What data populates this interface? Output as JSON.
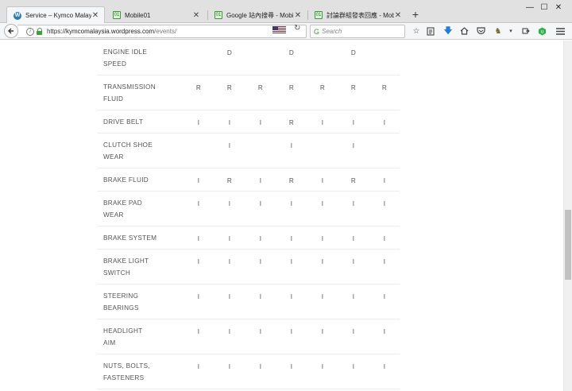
{
  "tabs": [
    {
      "label": "Service – Kymco Malaysia",
      "favicon": "wordpress-icon",
      "active": true
    },
    {
      "label": "Mobile01",
      "favicon": "mobile01-icon",
      "active": false
    },
    {
      "label": "Google 站內搜尋 - Mobile...",
      "favicon": "mobile01-icon",
      "active": false
    },
    {
      "label": "討論群組發表回應 - Mobil...",
      "favicon": "mobile01-icon",
      "active": false
    }
  ],
  "window": {
    "minimize": "—",
    "maximize": "☐",
    "close": "✕",
    "new_tab": "+"
  },
  "address": {
    "protocol": "https://",
    "host": "kymcomalaysia.wordpress.com",
    "path": "/events/"
  },
  "search": {
    "placeholder": "Search"
  },
  "table": {
    "rows": [
      {
        "item": [
          "ENGINE IDLE",
          "SPEED"
        ],
        "values": [
          "",
          "D",
          "",
          "D",
          "",
          "D",
          ""
        ]
      },
      {
        "item": [
          "TRANSMISSION",
          "FLUID"
        ],
        "values": [
          "R",
          "R",
          "R",
          "R",
          "R",
          "R",
          "R"
        ]
      },
      {
        "item": [
          "DRIVE BELT"
        ],
        "values": [
          "I",
          "I",
          "I",
          "R",
          "I",
          "I",
          "I"
        ]
      },
      {
        "item": [
          "CLUTCH SHOE",
          "WEAR"
        ],
        "values": [
          "",
          "I",
          "",
          "I",
          "",
          "I",
          ""
        ]
      },
      {
        "item": [
          "BRAKE FLUID"
        ],
        "values": [
          "I",
          "R",
          "I",
          "R",
          "I",
          "R",
          "I"
        ]
      },
      {
        "item": [
          "BRAKE PAD",
          "WEAR"
        ],
        "values": [
          "I",
          "I",
          "I",
          "I",
          "I",
          "I",
          "I"
        ]
      },
      {
        "item": [
          "BRAKE SYSTEM"
        ],
        "values": [
          "I",
          "I",
          "I",
          "I",
          "I",
          "I",
          "I"
        ]
      },
      {
        "item": [
          "BRAKE LIGHT",
          "SWITCH"
        ],
        "values": [
          "I",
          "I",
          "I",
          "I",
          "I",
          "I",
          "I"
        ]
      },
      {
        "item": [
          "STEERING",
          "BEARINGS"
        ],
        "values": [
          "I",
          "I",
          "I",
          "I",
          "I",
          "I",
          "I"
        ]
      },
      {
        "item": [
          "HEADLIGHT",
          "AIM"
        ],
        "values": [
          "I",
          "I",
          "I",
          "I",
          "I",
          "I",
          "I"
        ]
      },
      {
        "item": [
          "NUTS, BOLTS,",
          "FASTENERS"
        ],
        "values": [
          "I",
          "I",
          "I",
          "I",
          "I",
          "I",
          "I"
        ]
      }
    ]
  }
}
